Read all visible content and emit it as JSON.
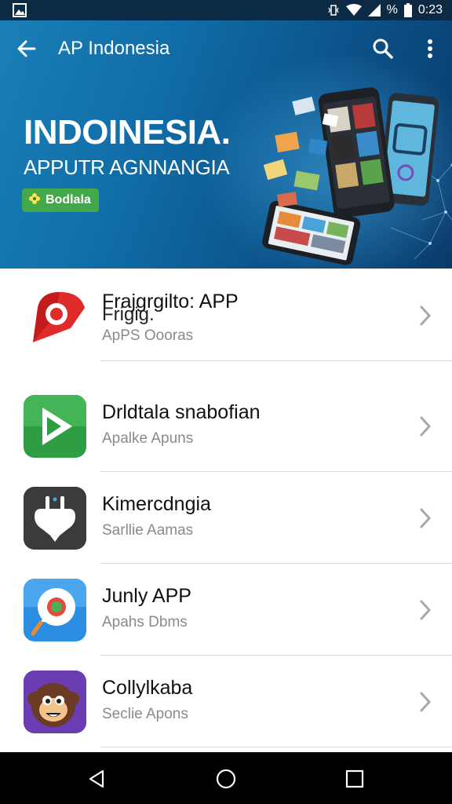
{
  "status_bar": {
    "time": "0:23",
    "icons": [
      "image-icon",
      "vibrate-icon",
      "wifi-icon",
      "signal-icon",
      "battery-icon"
    ],
    "battery_text": "%"
  },
  "app_bar": {
    "title": "AP Indonesia",
    "icons": [
      "back-arrow-icon",
      "search-icon",
      "more-vert-icon"
    ]
  },
  "hero": {
    "title": "INDOINESIA.",
    "subtitle": "APPUTR AGNNANGIA",
    "badge_label": "Bodlala",
    "colors": {
      "gradient_start": "#1a7fb8",
      "gradient_end": "#0a3a6a",
      "badge": "#43a84a"
    }
  },
  "apps": [
    {
      "name": "Frajgrgilto: APP",
      "name_overlay": "Frigig.",
      "subtitle": "ApPS Oooras",
      "icon": "red-map-pin-icon"
    },
    {
      "name": "Drldtala snabofian",
      "subtitle": "Apalke Apuns",
      "icon": "green-play-icon"
    },
    {
      "name": "Kimercdngia",
      "subtitle": "Sarllie Aamas",
      "icon": "dark-plug-icon"
    },
    {
      "name": "Junly APP",
      "subtitle": "Apahs Dbms",
      "icon": "blue-chat-bubble-icon"
    },
    {
      "name": "Collylkaba",
      "subtitle": "Seclie Apons",
      "icon": "purple-monkey-icon"
    }
  ],
  "nav_bar": {
    "icons": [
      "nav-back-icon",
      "nav-home-icon",
      "nav-recents-icon"
    ]
  }
}
